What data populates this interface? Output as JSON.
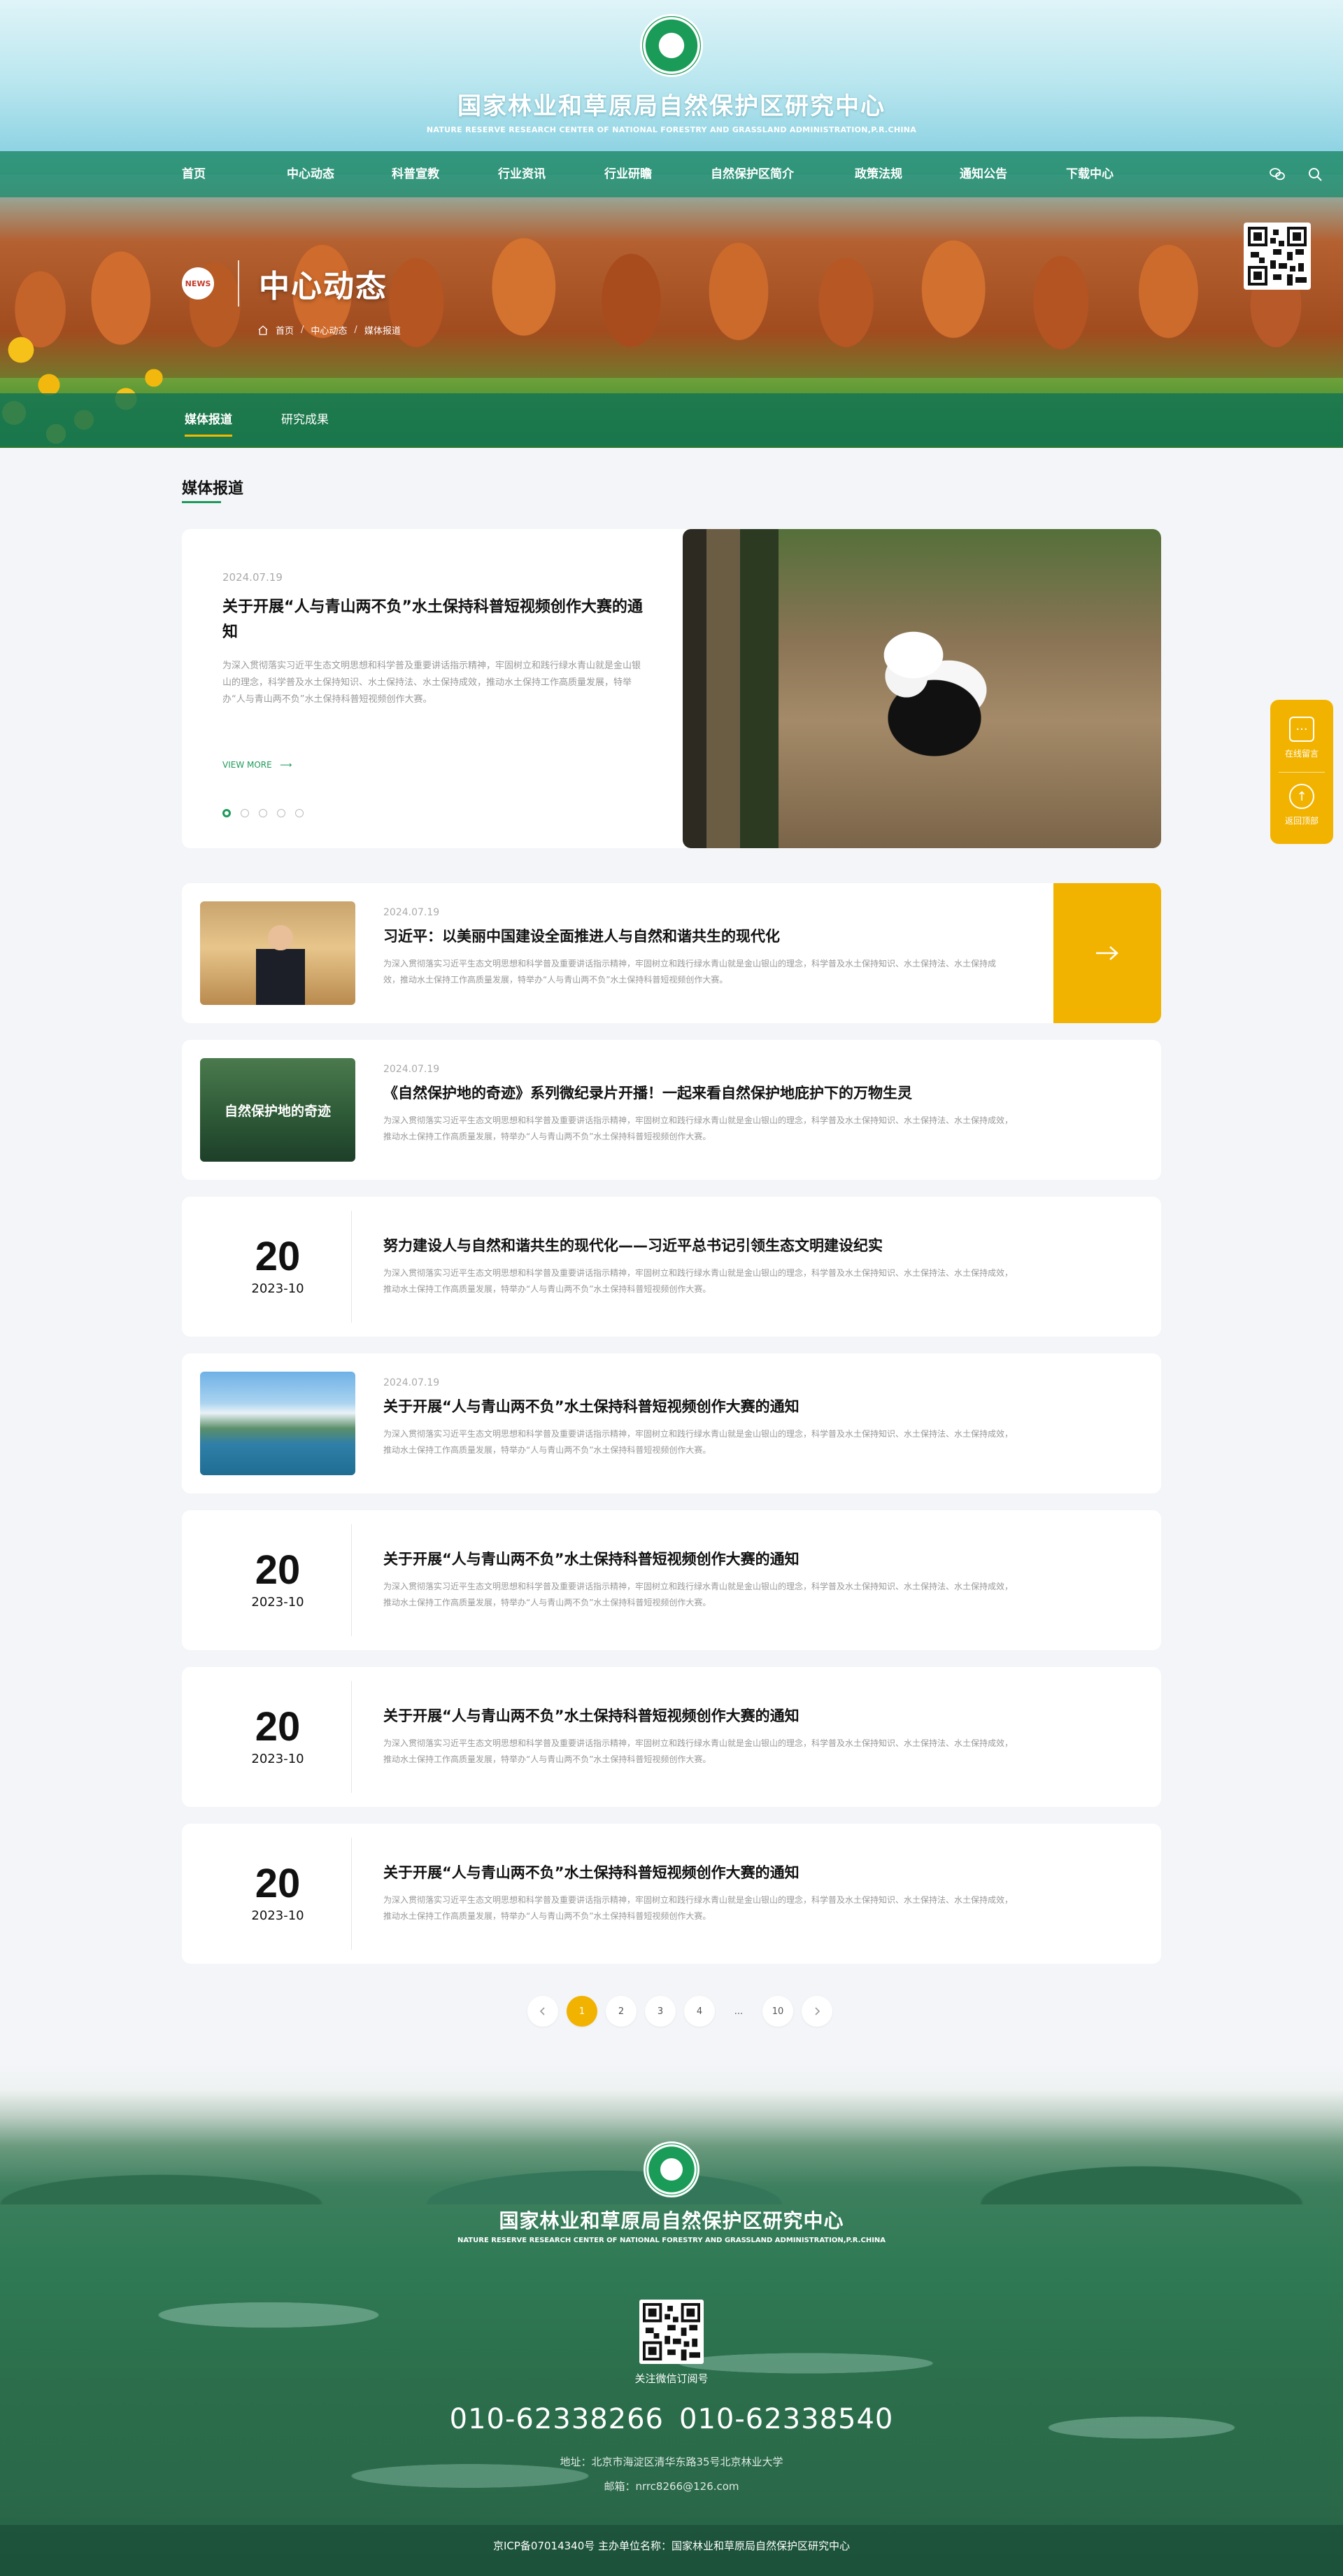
{
  "header": {
    "title": "国家林业和草原局自然保护区研究中心",
    "subtitle": "NATURE RESERVE RESEARCH CENTER OF NATIONAL FORESTRY AND GRASSLAND ADMINISTRATION,P.R.CHINA"
  },
  "nav": {
    "items": [
      "首页",
      "中心动态",
      "科普宣教",
      "行业资讯",
      "行业研瞻",
      "自然保护区简介",
      "政策法规",
      "通知公告",
      "下载中心"
    ]
  },
  "page_head": {
    "badge": "NEWS",
    "title": "中心动态",
    "breadcrumb": [
      "首页",
      "中心动态",
      "媒体报道"
    ]
  },
  "subnav": {
    "items": [
      "媒体报道",
      "研究成果"
    ]
  },
  "section": {
    "title": "媒体报道"
  },
  "featured": {
    "date": "2024.07.19",
    "title": "关于开展“人与青山两不负”水土保持科普短视频创作大赛的通知",
    "desc": "为深入贯彻落实习近平生态文明思想和科学普及重要讲话指示精神，牢固树立和践行绿水青山就是金山银山的理念，科学普及水土保持知识、水土保持法、水土保持成效，推动水土保持工作高质量发展，特举办“人与青山两不负”水土保持科普短视频创作大赛。",
    "more": "VIEW MORE"
  },
  "list": [
    {
      "date": "2024.07.19",
      "title": "习近平：以美丽中国建设全面推进人与自然和谐共生的现代化",
      "desc": "为深入贯彻落实习近平生态文明思想和科学普及重要讲话指示精神，牢固树立和践行绿水青山就是金山银山的理念，科学普及水土保持知识、水土保持法、水土保持成效，推动水土保持工作高质量发展，特举办“人与青山两不负”水土保持科普短视频创作大赛。"
    },
    {
      "date": "2024.07.19",
      "title": "《自然保护地的奇迹》系列微纪录片开播！一起来看自然保护地庇护下的万物生灵",
      "desc": "为深入贯彻落实习近平生态文明思想和科学普及重要讲话指示精神，牢固树立和践行绿水青山就是金山银山的理念，科学普及水土保持知识、水土保持法、水土保持成效，推动水土保持工作高质量发展，特举办“人与青山两不负”水土保持科普短视频创作大赛。",
      "thumb_text": "自然保护地的奇迹"
    },
    {
      "day": "20",
      "ym": "2023-10",
      "title": "努力建设人与自然和谐共生的现代化——习近平总书记引领生态文明建设纪实",
      "desc": "为深入贯彻落实习近平生态文明思想和科学普及重要讲话指示精神，牢固树立和践行绿水青山就是金山银山的理念，科学普及水土保持知识、水土保持法、水土保持成效，推动水土保持工作高质量发展，特举办“人与青山两不负”水土保持科普短视频创作大赛。"
    },
    {
      "date": "2024.07.19",
      "title": "关于开展“人与青山两不负”水土保持科普短视频创作大赛的通知",
      "desc": "为深入贯彻落实习近平生态文明思想和科学普及重要讲话指示精神，牢固树立和践行绿水青山就是金山银山的理念，科学普及水土保持知识、水土保持法、水土保持成效，推动水土保持工作高质量发展，特举办“人与青山两不负”水土保持科普短视频创作大赛。"
    },
    {
      "day": "20",
      "ym": "2023-10",
      "title": "关于开展“人与青山两不负”水土保持科普短视频创作大赛的通知",
      "desc": "为深入贯彻落实习近平生态文明思想和科学普及重要讲话指示精神，牢固树立和践行绿水青山就是金山银山的理念，科学普及水土保持知识、水土保持法、水土保持成效，推动水土保持工作高质量发展，特举办“人与青山两不负”水土保持科普短视频创作大赛。"
    },
    {
      "day": "20",
      "ym": "2023-10",
      "title": "关于开展“人与青山两不负”水土保持科普短视频创作大赛的通知",
      "desc": "为深入贯彻落实习近平生态文明思想和科学普及重要讲话指示精神，牢固树立和践行绿水青山就是金山银山的理念，科学普及水土保持知识、水土保持法、水土保持成效，推动水土保持工作高质量发展，特举办“人与青山两不负”水土保持科普短视频创作大赛。"
    },
    {
      "day": "20",
      "ym": "2023-10",
      "title": "关于开展“人与青山两不负”水土保持科普短视频创作大赛的通知",
      "desc": "为深入贯彻落实习近平生态文明思想和科学普及重要讲话指示精神，牢固树立和践行绿水青山就是金山银山的理念，科学普及水土保持知识、水土保持法、水土保持成效，推动水土保持工作高质量发展，特举办“人与青山两不负”水土保持科普短视频创作大赛。"
    }
  ],
  "pager": {
    "pages": [
      "1",
      "2",
      "3",
      "4",
      "...",
      "10"
    ],
    "current": "1"
  },
  "side_tools": {
    "message": "在线留言",
    "top": "返回顶部"
  },
  "footer": {
    "title": "国家林业和草原局自然保护区研究中心",
    "subtitle": "NATURE RESERVE RESEARCH CENTER OF NATIONAL FORESTRY AND GRASSLAND ADMINISTRATION,P.R.CHINA",
    "qr_label": "关注微信订阅号",
    "phone1": "010-62338266",
    "phone2": "010-62338540",
    "address": "地址：北京市海淀区清华东路35号北京林业大学",
    "email": "邮箱：nrrc8266@126.com",
    "icp": "京ICP备07014340号 主办单位名称：国家林业和草原局自然保护区研究中心"
  },
  "colors": {
    "brand_green": "#1e9a5a",
    "accent_yellow": "#f2b300",
    "nav_green": "#228c6e"
  },
  "icons": {
    "wechat": "wechat-icon",
    "search": "search-icon",
    "home": "home-icon",
    "arrow": "arrow-right-icon",
    "message": "chat-icon",
    "top": "arrow-up-icon"
  }
}
